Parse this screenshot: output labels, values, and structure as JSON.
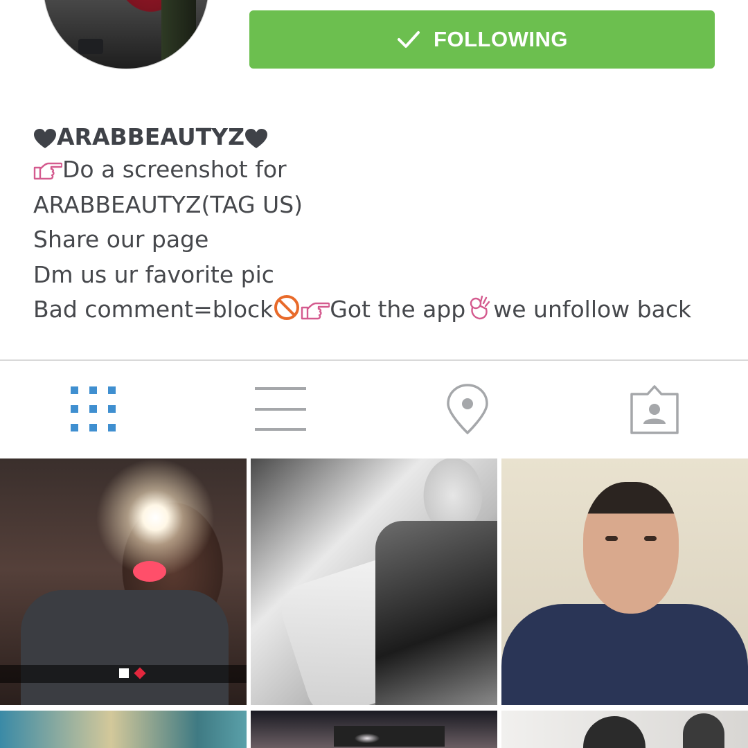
{
  "profile": {
    "follow_button_label": "FOLLOWING",
    "name": "ARABBEAUTYZ",
    "bio_lines": [
      "Do a screenshot for",
      "ARABBEAUTYZ(TAG US)",
      "Share our page",
      "Dm us ur favorite pic"
    ],
    "bio_last_line": {
      "part1": "Bad comment=block",
      "part2": "Got the app",
      "part3": "we unfollow back"
    }
  },
  "tabs": [
    {
      "name": "grid-view",
      "icon": "grid-icon",
      "active": true
    },
    {
      "name": "list-view",
      "icon": "list-icon",
      "active": false
    },
    {
      "name": "map-view",
      "icon": "location-pin-icon",
      "active": false
    },
    {
      "name": "tagged-photos",
      "icon": "tagged-person-icon",
      "active": false
    }
  ],
  "colors": {
    "follow_green": "#6cbf4f",
    "active_tab_blue": "#3f8fd0",
    "inactive_tab_gray": "#a5a7aa",
    "emoji_pink": "#d45a8e",
    "block_orange": "#e86a2a"
  }
}
